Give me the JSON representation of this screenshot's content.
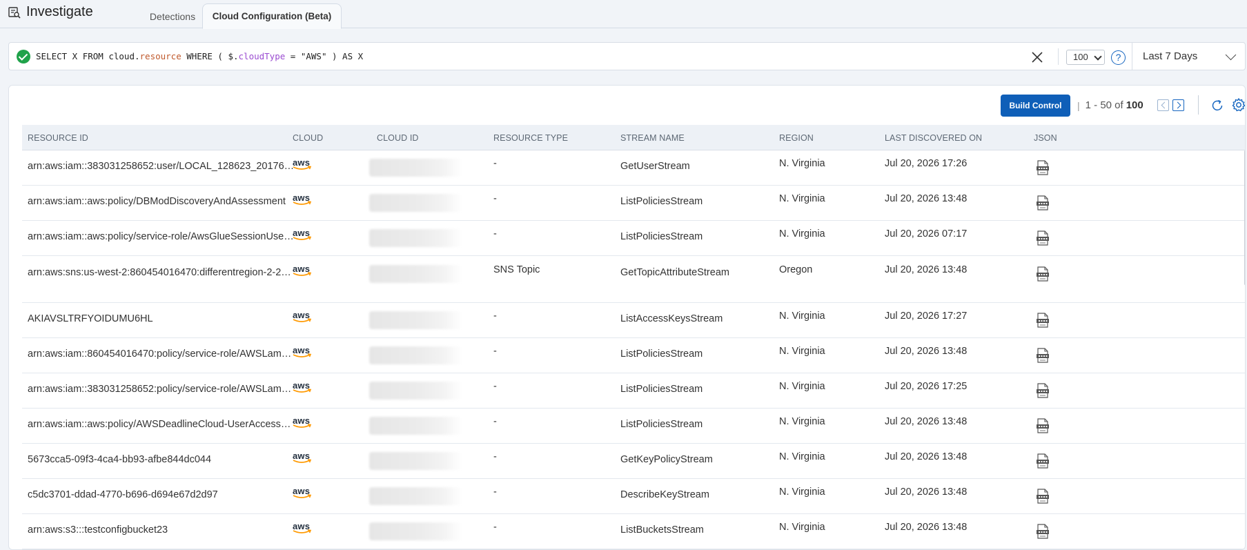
{
  "app": {
    "title": "Investigate"
  },
  "tabs": [
    {
      "label": "Detections",
      "active": false
    },
    {
      "label": "Cloud Configuration (Beta)",
      "active": true
    }
  ],
  "query": {
    "status": "valid",
    "text_parts": [
      {
        "text": "SELECT X FROM cloud.",
        "style": "plain"
      },
      {
        "text": "resource",
        "style": "orange"
      },
      {
        "text": " WHERE ( $.",
        "style": "plain"
      },
      {
        "text": "cloudType",
        "style": "purple"
      },
      {
        "text": " = \"AWS\" ) AS X",
        "style": "plain"
      }
    ],
    "limit": "100",
    "help_label": "?",
    "time_range": "Last 7 Days"
  },
  "toolbar": {
    "build_control_label": "Build Control",
    "page_range": "1 - 50 of",
    "page_total": "100"
  },
  "columns": [
    "RESOURCE ID",
    "CLOUD",
    "CLOUD ID",
    "RESOURCE TYPE",
    "STREAM NAME",
    "REGION",
    "LAST DISCOVERED ON",
    "JSON"
  ],
  "rows": [
    {
      "resource_id": "arn:aws:iam::383031258652:user/LOCAL_128623_20176…",
      "cloud": "aws",
      "resource_type": "-",
      "stream": "GetUserStream",
      "region": "N. Virginia",
      "last_discovered": "Jul 20, 2026 17:26"
    },
    {
      "resource_id": "arn:aws:iam::aws:policy/DBModDiscoveryAndAssessment",
      "cloud": "aws",
      "resource_type": "-",
      "stream": "ListPoliciesStream",
      "region": "N. Virginia",
      "last_discovered": "Jul 20, 2026 13:48"
    },
    {
      "resource_id": "arn:aws:iam::aws:policy/service-role/AwsGlueSessionUse…",
      "cloud": "aws",
      "resource_type": "-",
      "stream": "ListPoliciesStream",
      "region": "N. Virginia",
      "last_discovered": "Jul 20, 2026 07:17"
    },
    {
      "resource_id": "arn:aws:sns:us-west-2:860454016470:differentregion-2-2…",
      "cloud": "aws",
      "resource_type": "SNS Topic",
      "stream": "GetTopicAttributeStream",
      "region": "Oregon",
      "last_discovered": "Jul 20, 2026 13:48"
    },
    {
      "resource_id": "AKIAVSLTRFYOIDUMU6HL",
      "cloud": "aws",
      "resource_type": "-",
      "stream": "ListAccessKeysStream",
      "region": "N. Virginia",
      "last_discovered": "Jul 20, 2026 17:27"
    },
    {
      "resource_id": "arn:aws:iam::860454016470:policy/service-role/AWSLam…",
      "cloud": "aws",
      "resource_type": "-",
      "stream": "ListPoliciesStream",
      "region": "N. Virginia",
      "last_discovered": "Jul 20, 2026 13:48"
    },
    {
      "resource_id": "arn:aws:iam::383031258652:policy/service-role/AWSLam…",
      "cloud": "aws",
      "resource_type": "-",
      "stream": "ListPoliciesStream",
      "region": "N. Virginia",
      "last_discovered": "Jul 20, 2026 17:25"
    },
    {
      "resource_id": "arn:aws:iam::aws:policy/AWSDeadlineCloud-UserAccess…",
      "cloud": "aws",
      "resource_type": "-",
      "stream": "ListPoliciesStream",
      "region": "N. Virginia",
      "last_discovered": "Jul 20, 2026 13:48"
    },
    {
      "resource_id": "5673cca5-09f3-4ca4-bb93-afbe844dc044",
      "cloud": "aws",
      "resource_type": "-",
      "stream": "GetKeyPolicyStream",
      "region": "N. Virginia",
      "last_discovered": "Jul 20, 2026 13:48"
    },
    {
      "resource_id": "c5dc3701-ddad-4770-b696-d694e67d2d97",
      "cloud": "aws",
      "resource_type": "-",
      "stream": "DescribeKeyStream",
      "region": "N. Virginia",
      "last_discovered": "Jul 20, 2026 13:48"
    },
    {
      "resource_id": "arn:aws:s3:::testconfigbucket23",
      "cloud": "aws",
      "resource_type": "-",
      "stream": "ListBucketsStream",
      "region": "N. Virginia",
      "last_discovered": "Jul 20, 2026 13:48"
    }
  ],
  "colors": {
    "accent": "#0f5fb8",
    "valid": "#1fa24a",
    "aws_orange": "#ff9900"
  }
}
